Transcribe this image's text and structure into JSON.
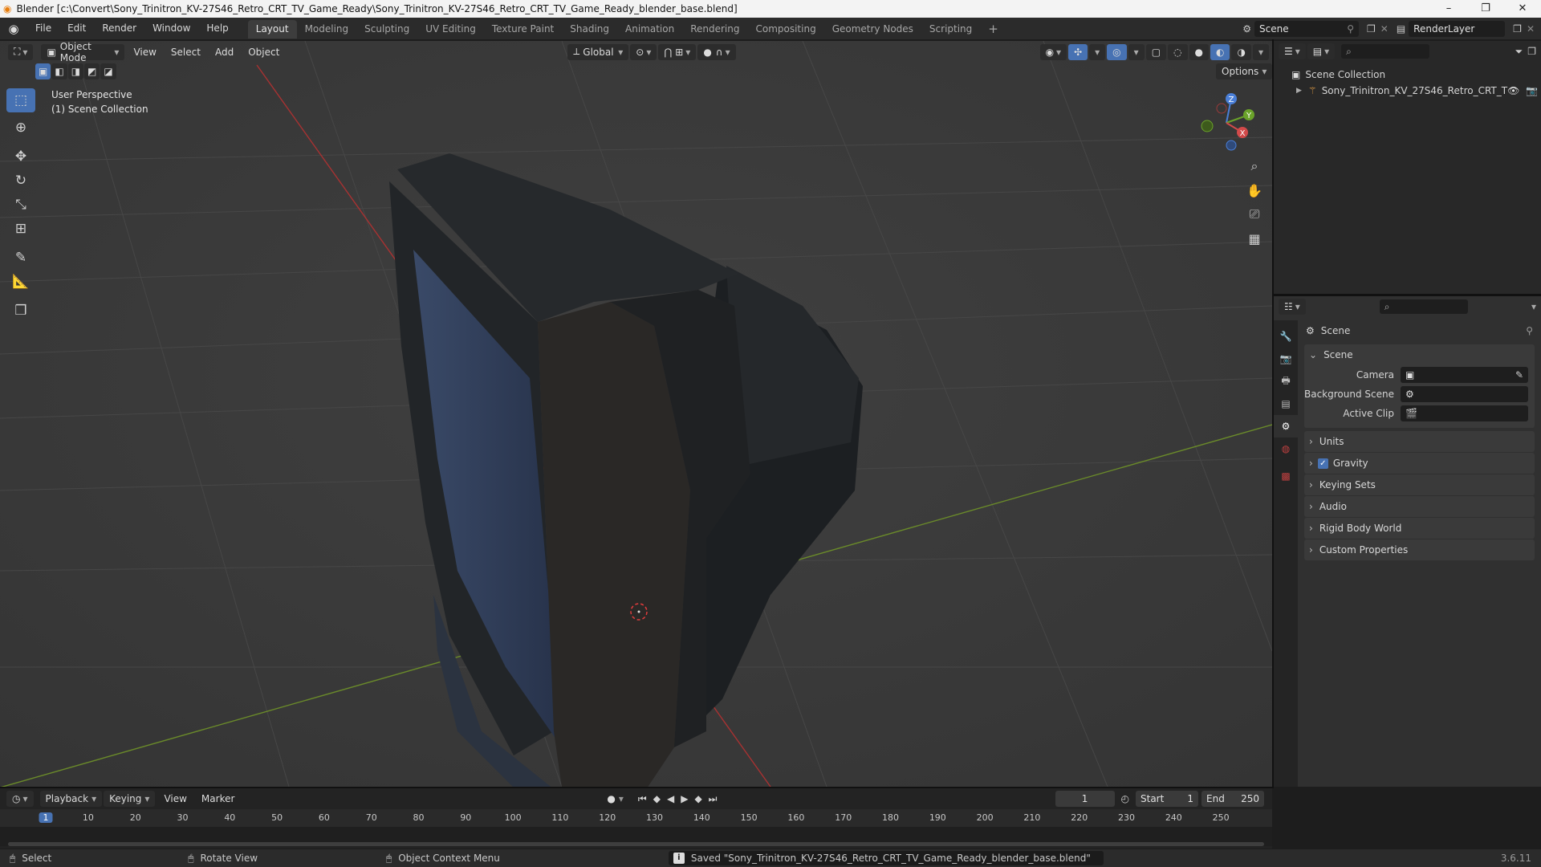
{
  "window": {
    "title": "Blender [c:\\Convert\\Sony_Trinitron_KV-27S46_Retro_CRT_TV_Game_Ready\\Sony_Trinitron_KV-27S46_Retro_CRT_TV_Game_Ready_blender_base.blend]",
    "minimize": "–",
    "maximize": "❐",
    "close": "✕"
  },
  "menubar": {
    "items": [
      "File",
      "Edit",
      "Render",
      "Window",
      "Help"
    ]
  },
  "workspaces": {
    "tabs": [
      "Layout",
      "Modeling",
      "Sculpting",
      "UV Editing",
      "Texture Paint",
      "Shading",
      "Animation",
      "Rendering",
      "Compositing",
      "Geometry Nodes",
      "Scripting"
    ],
    "active": "Layout",
    "add": "+"
  },
  "scene_selector": {
    "value": "Scene"
  },
  "view_layer": {
    "value": "RenderLayer"
  },
  "viewport_header": {
    "mode": "Object Mode",
    "menus": [
      "View",
      "Select",
      "Add",
      "Object"
    ],
    "transform_orientation": "Global",
    "options": "Options"
  },
  "viewport": {
    "overlay_line1": "User Perspective",
    "overlay_line2": "(1) Scene Collection",
    "gizmo": {
      "z": "Z",
      "y": "Y",
      "x": "X"
    }
  },
  "outliner": {
    "root": "Scene Collection",
    "object": "Sony_Trinitron_KV_27S46_Retro_CRT_T"
  },
  "properties": {
    "context_title": "Scene",
    "panel_scene": "Scene",
    "camera_label": "Camera",
    "background_scene_label": "Background Scene",
    "active_clip_label": "Active Clip",
    "sections": [
      "Units",
      "Gravity",
      "Keying Sets",
      "Audio",
      "Rigid Body World",
      "Custom Properties"
    ],
    "gravity_checked": true
  },
  "timeline": {
    "menus": [
      "Playback",
      "Keying",
      "View",
      "Marker"
    ],
    "current_frame": "1",
    "start_label": "Start",
    "start_value": "1",
    "end_label": "End",
    "end_value": "250",
    "ruler": [
      "1",
      "10",
      "20",
      "30",
      "40",
      "50",
      "60",
      "70",
      "80",
      "90",
      "100",
      "110",
      "120",
      "130",
      "140",
      "150",
      "160",
      "170",
      "180",
      "190",
      "200",
      "210",
      "220",
      "230",
      "240",
      "250"
    ]
  },
  "statusbar": {
    "select": "Select",
    "rotate": "Rotate View",
    "context_menu": "Object Context Menu",
    "message": "Saved \"Sony_Trinitron_KV-27S46_Retro_CRT_TV_Game_Ready_blender_base.blend\"",
    "version": "3.6.11"
  }
}
